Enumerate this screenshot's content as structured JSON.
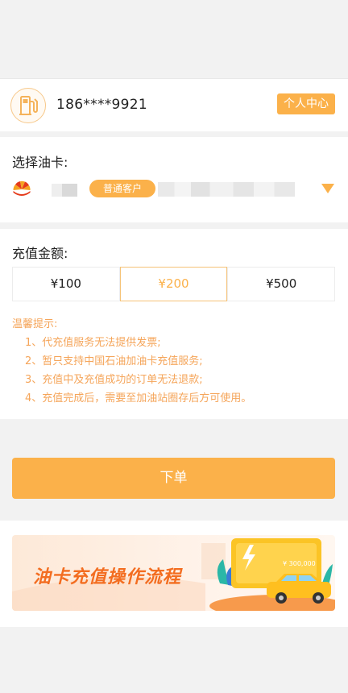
{
  "user": {
    "phone": "186****9921",
    "center_label": "个人中心"
  },
  "card_section": {
    "label": "选择油卡:",
    "customer_tag": "普通客户"
  },
  "amount_section": {
    "label": "充值金额:",
    "options": [
      "¥100",
      "¥200",
      "¥500"
    ],
    "selected": "¥200"
  },
  "tips": {
    "title": "温馨提示:",
    "items": [
      "1、代充值服务无法提供发票;",
      "2、暂只支持中国石油加油卡充值服务;",
      "3、充值中及充值成功的订单无法退款;",
      "4、充值完成后，需要至加油站圈存后方可使用。"
    ]
  },
  "order_button": "下单",
  "banner": {
    "title": "油卡充值操作流程",
    "card_text": "¥ 300,000"
  },
  "colors": {
    "accent": "#fbb14a",
    "tip": "#f5a55a",
    "banner_title": "#f36d20"
  }
}
